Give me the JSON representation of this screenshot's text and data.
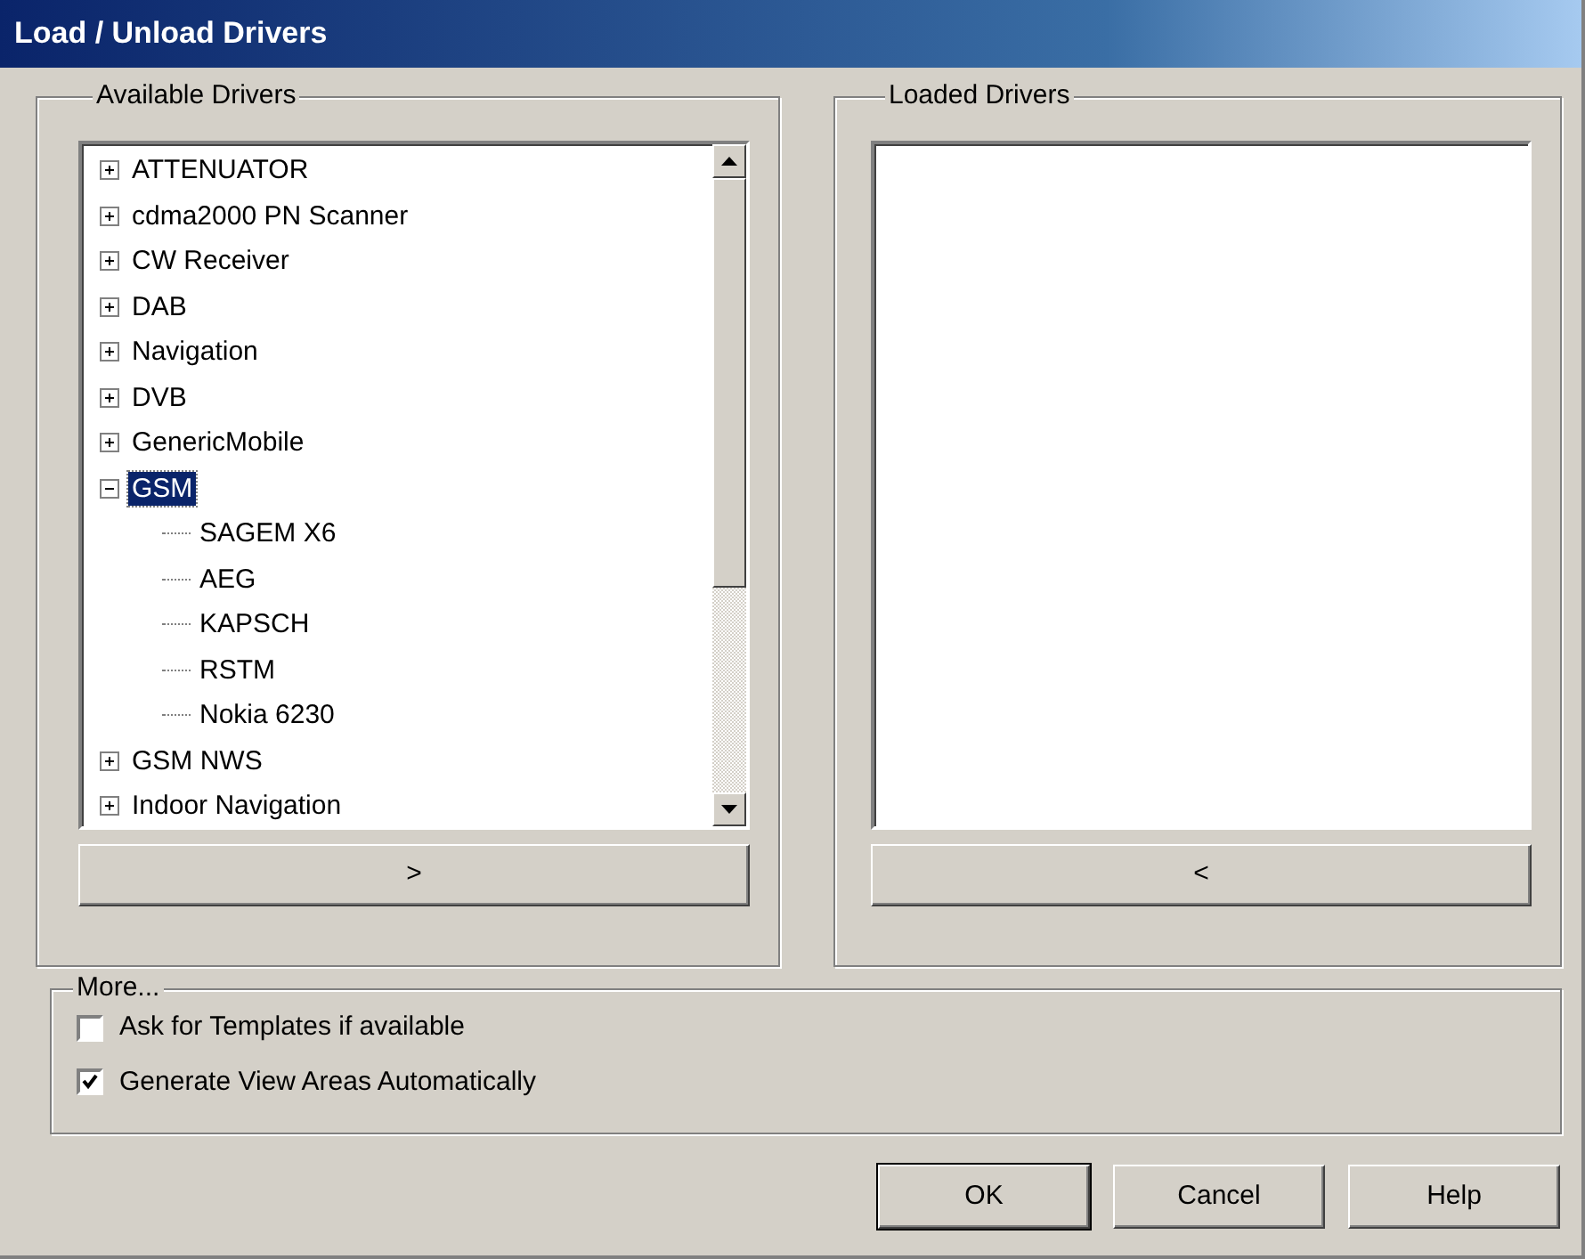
{
  "window": {
    "title": "Load / Unload Drivers"
  },
  "available": {
    "label": "Available Drivers",
    "tree": [
      {
        "label": "ATTENUATOR",
        "expanded": false,
        "selected": false
      },
      {
        "label": "cdma2000 PN Scanner",
        "expanded": false,
        "selected": false
      },
      {
        "label": "CW Receiver",
        "expanded": false,
        "selected": false
      },
      {
        "label": "DAB",
        "expanded": false,
        "selected": false
      },
      {
        "label": "Navigation",
        "expanded": false,
        "selected": false
      },
      {
        "label": "DVB",
        "expanded": false,
        "selected": false
      },
      {
        "label": "GenericMobile",
        "expanded": false,
        "selected": false
      },
      {
        "label": "GSM",
        "expanded": true,
        "selected": true,
        "children": [
          {
            "label": "SAGEM X6",
            "selected": false
          },
          {
            "label": "AEG",
            "selected": false
          },
          {
            "label": "KAPSCH",
            "selected": false
          },
          {
            "label": "RSTM",
            "selected": false
          },
          {
            "label": "Nokia 6230",
            "selected": false
          }
        ]
      },
      {
        "label": "GSM NWS",
        "expanded": false,
        "selected": false
      },
      {
        "label": "Indoor Navigation",
        "expanded": false,
        "selected": false
      }
    ],
    "button": ">"
  },
  "loaded": {
    "label": "Loaded Drivers",
    "button": "<"
  },
  "more": {
    "label": "More...",
    "options": [
      {
        "label": "Ask for Templates if available",
        "checked": false
      },
      {
        "label": "Generate View Areas Automatically",
        "checked": true
      }
    ]
  },
  "buttons": [
    {
      "label": "OK",
      "default": true
    },
    {
      "label": "Cancel",
      "default": false
    },
    {
      "label": "Help",
      "default": false
    }
  ]
}
